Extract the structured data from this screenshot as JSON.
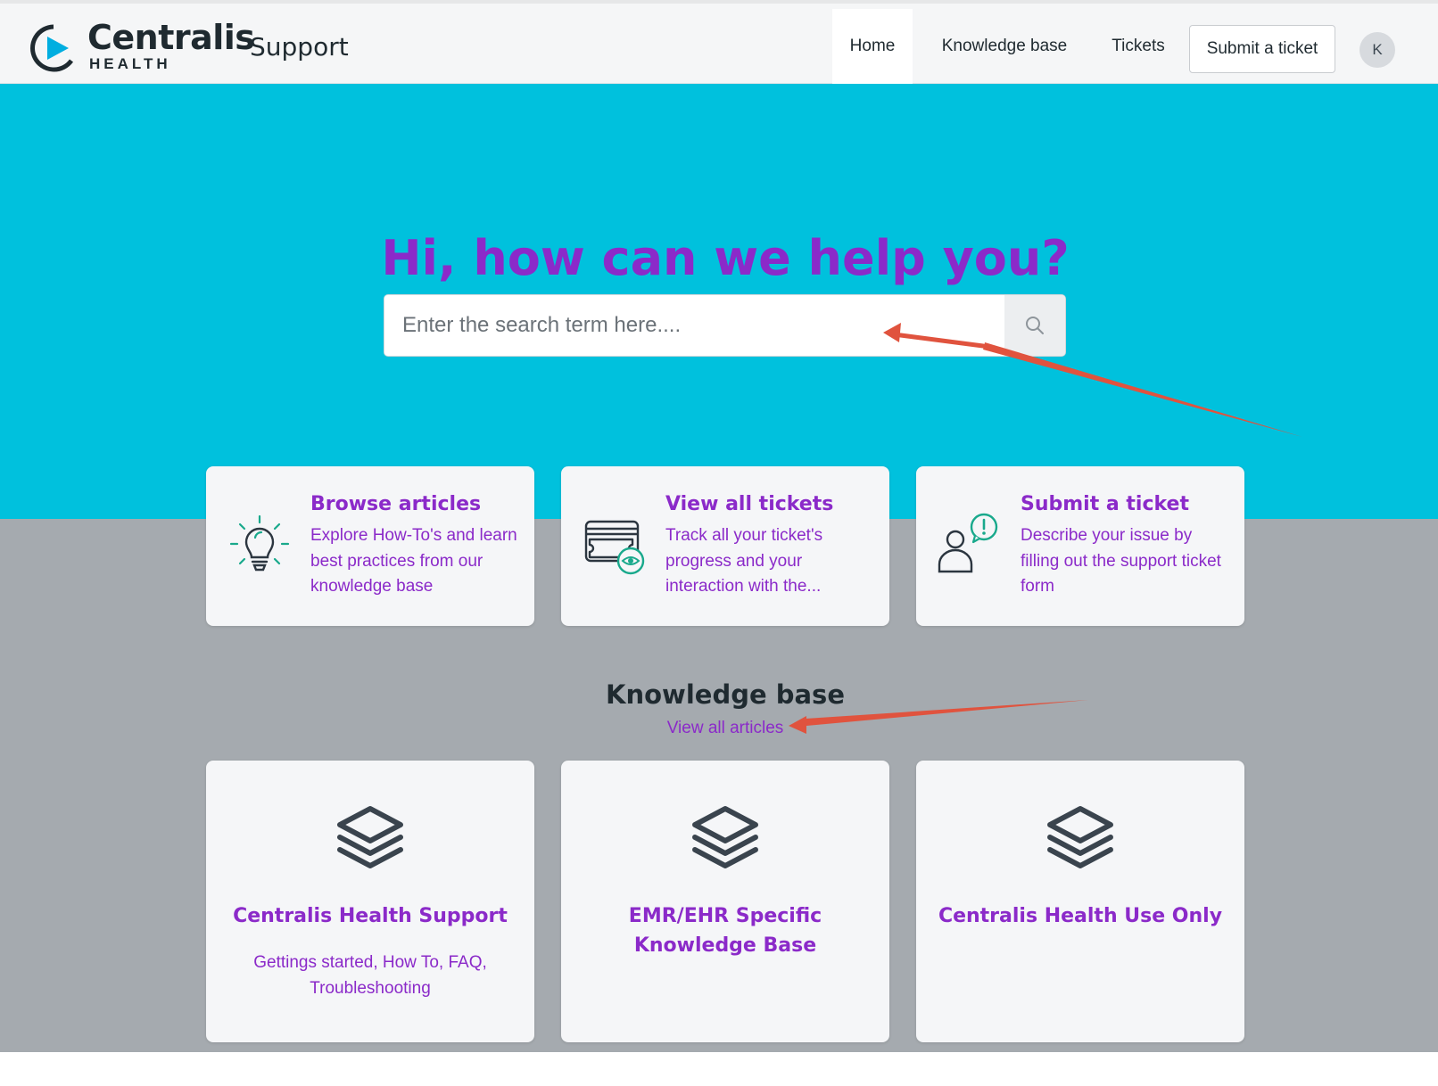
{
  "brand": {
    "name": "Centralis",
    "sub": "HEALTH",
    "product": "Support"
  },
  "nav": {
    "home": "Home",
    "knowledge_base": "Knowledge base",
    "tickets": "Tickets",
    "submit": "Submit a ticket",
    "avatar_initial": "K"
  },
  "hero": {
    "title": "Hi, how can we help you?",
    "search_placeholder": "Enter the search term here...."
  },
  "actions": [
    {
      "title": "Browse articles",
      "description": "Explore How-To's and learn best practices from our knowledge base",
      "icon": "lightbulb-icon"
    },
    {
      "title": "View all tickets",
      "description": "Track all your ticket's progress and your interaction with the...",
      "icon": "ticket-view-icon"
    },
    {
      "title": "Submit a ticket",
      "description": "Describe your issue by filling out the support ticket form",
      "icon": "person-alert-icon"
    }
  ],
  "knowledge_base": {
    "heading": "Knowledge base",
    "view_all": "View all articles",
    "categories": [
      {
        "title": "Centralis Health Support",
        "description": "Gettings started, How To, FAQ, Troubleshooting"
      },
      {
        "title": "EMR/EHR Specific Knowledge Base",
        "description": ""
      },
      {
        "title": "Centralis Health Use Only",
        "description": ""
      }
    ]
  },
  "colors": {
    "accent": "#8b2ac9",
    "hero_bg": "#00c1dd",
    "section_bg": "#a5aaaf",
    "icon_green": "#19a98c",
    "annotation_arrow": "#e0533e"
  }
}
